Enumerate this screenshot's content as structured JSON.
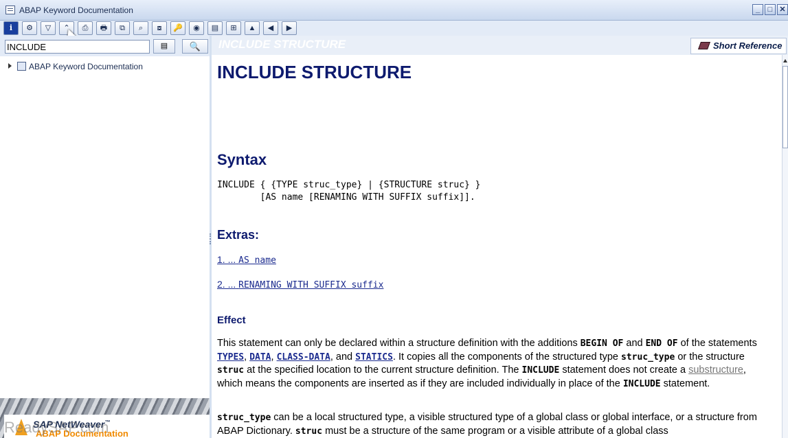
{
  "window": {
    "title": "ABAP Keyword Documentation",
    "min_label": "_",
    "max_label": "□",
    "close_label": "✕"
  },
  "toolbar": {
    "info_label": "i",
    "icons": [
      "⚙",
      "▽",
      "⌃",
      "⎙",
      "🖶",
      "⧉",
      "⌕",
      "⧇",
      "🔑",
      "◉",
      "▤",
      "⊞",
      "▲",
      "◀",
      "▶"
    ]
  },
  "search": {
    "value": "INCLUDE",
    "filter_icon": "▤",
    "search_icon": "🔍"
  },
  "tree": {
    "root_label": "ABAP Keyword Documentation"
  },
  "banner": {
    "product": "SAP NetWeaver",
    "tm": "™",
    "subtitle": "ABAP Documentation",
    "watermark": "ReadySAP.com"
  },
  "header": {
    "faded_title": "INCLUDE STRUCTURE",
    "short_reference": "Short Reference"
  },
  "doc": {
    "title": "INCLUDE STRUCTURE",
    "syntax_heading": "Syntax",
    "syntax_code": "INCLUDE { {TYPE struc_type} | {STRUCTURE struc} }\n        [AS name [RENAMING WITH SUFFIX suffix]].",
    "extras_heading": "Extras:",
    "extra1_num": "1. ...",
    "extra1_code": "AS name",
    "extra2_num": "2. ...",
    "extra2_code": "RENAMING WITH SUFFIX suffix",
    "effect_heading": "Effect",
    "p1": {
      "t1": "This statement can only be declared within a structure definition with the additions ",
      "k1": "BEGIN OF",
      "t2": " and ",
      "k2": "END OF",
      "t3": " of the statements ",
      "l1": "TYPES",
      "t4": ", ",
      "l2": "DATA",
      "t5": ", ",
      "l3": "CLASS-DATA",
      "t6": ", and ",
      "l4": "STATICS",
      "t7": ". It copies all the components of the structured type ",
      "k3": "struc_type",
      "t8": " or the structure ",
      "k4": "struc",
      "t9": " at the specified location to the current structure definition. The ",
      "k5": "INCLUDE",
      "t10": " statement does not create a ",
      "g1": "substructure",
      "t11": ", which means the components are inserted as if they are included individually in place of the ",
      "k6": "INCLUDE",
      "t12": " statement."
    },
    "p2": {
      "k1": "struc_type",
      "t1": " can be a local structured type, a visible structured type of a global class or global interface, or a structure from ABAP Dictionary. ",
      "k2": "struc",
      "t2": " must be a structure of the same program or a visible attribute of a global class"
    }
  }
}
